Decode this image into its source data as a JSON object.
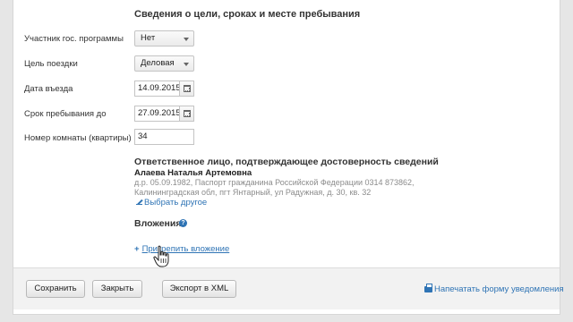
{
  "section": {
    "title": "Сведения о цели, сроках и месте пребывания"
  },
  "fields": {
    "program": {
      "label": "Участник гос. программы",
      "value": "Нет"
    },
    "purpose": {
      "label": "Цель поездки",
      "value": "Деловая"
    },
    "entry_date": {
      "label": "Дата въезда",
      "value": "14.09.2015"
    },
    "stay_until": {
      "label": "Срок пребывания до",
      "value": "27.09.2015"
    },
    "room": {
      "label": "Номер комнаты (квартиры)",
      "value": "34"
    }
  },
  "responsible": {
    "title": "Ответственное лицо, подтверждающее достоверность сведений",
    "name": "Алаева Наталья Артемовна",
    "details_line1": "д.р. 05.09.1982, Паспорт гражданина Российской Федерации 0314 873862,",
    "details_line2": "Калининградская обл, пгт Янтарный, ул Радужная, д. 30, кв. 32",
    "choose_other": "Выбрать другое"
  },
  "attachments": {
    "title": "Вложения",
    "help": "?",
    "attach_link": "Прикрепить вложение",
    "plus": "+"
  },
  "footer": {
    "save": "Сохранить",
    "close": "Закрыть",
    "export_xml": "Экспорт в XML",
    "print_notice": "Напечатать форму уведомления"
  },
  "colors": {
    "link": "#2f74b5",
    "panel_bg": "#ffffff",
    "page_bg": "#e6e6e6"
  }
}
